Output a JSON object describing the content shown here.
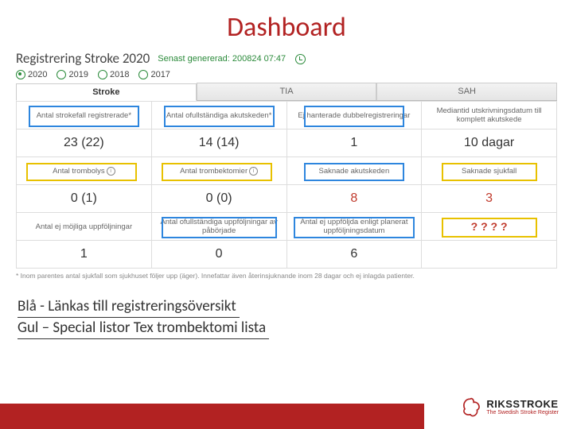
{
  "title": "Dashboard",
  "reg": {
    "heading": "Registrering Stroke 2020",
    "generated_label": "Senast genererad: 200824 07:47"
  },
  "years": [
    "2020",
    "2019",
    "2018",
    "2017"
  ],
  "year_selected": 0,
  "tabs": [
    "Stroke",
    "TIA",
    "SAH"
  ],
  "tab_selected": 0,
  "grid": {
    "r1": [
      "Antal strokefall registrerade*",
      "Antal ofullständiga akutskeden*",
      "Ej hanterade dubbelregistreringar",
      "Mediantid utskrivningsdatum till komplett akutskede"
    ],
    "r2": [
      "23 (22)",
      "14 (14)",
      "1",
      "10 dagar"
    ],
    "r3": [
      "Antal trombolys",
      "Antal trombektomier",
      "Saknade akutskeden",
      "Saknade sjukfall"
    ],
    "r4": [
      "0 (1)",
      "0 (0)",
      "8",
      "3"
    ],
    "r5": [
      "Antal ej möjliga uppföljningar",
      "Antal ofullständiga uppföljningar av påbörjade",
      "Antal ej uppföljda enligt planerat uppföljningsdatum",
      "? ? ? ?"
    ],
    "r6": [
      "1",
      "0",
      "6",
      ""
    ]
  },
  "footnote": "* Inom parentes antal sjukfall som sjukhuset följer upp (äger). Innefattar även återinsjuknande inom 28 dagar och ej inlagda patienter.",
  "legend": {
    "l1": "Blå  - Länkas till registreringsöversikt",
    "l2": "Gul – Special listor Tex trombektomi lista"
  },
  "logo": {
    "l1": "RIKSSTROKE",
    "l2": "The Swedish Stroke Register"
  }
}
